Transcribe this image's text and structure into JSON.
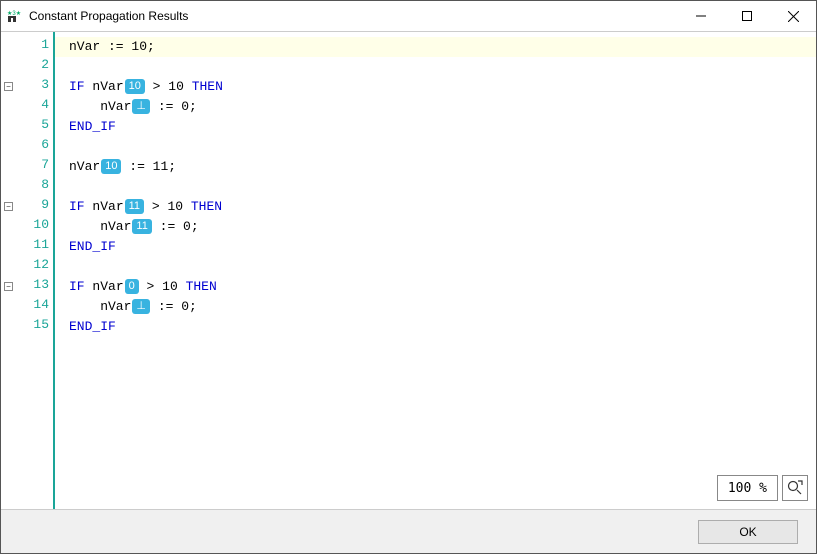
{
  "window": {
    "title": "Constant Propagation Results"
  },
  "zoom": {
    "label": "100 %"
  },
  "buttons": {
    "ok": "OK"
  },
  "line_h": 20,
  "top_off": 5,
  "folds": [
    3,
    9,
    13
  ],
  "code": [
    {
      "n": 1,
      "hl": true,
      "segs": [
        {
          "t": "nVar := 10;"
        }
      ]
    },
    {
      "n": 2,
      "segs": []
    },
    {
      "n": 3,
      "segs": [
        {
          "t": "IF",
          "kw": true
        },
        {
          "t": " nVar"
        },
        {
          "b": "10"
        },
        {
          "t": " > 10 "
        },
        {
          "t": "THEN",
          "kw": true
        }
      ]
    },
    {
      "n": 4,
      "segs": [
        {
          "t": "    nVar"
        },
        {
          "b": "⊥"
        },
        {
          "t": " := 0;"
        }
      ]
    },
    {
      "n": 5,
      "segs": [
        {
          "t": "END_IF",
          "kw": true
        }
      ]
    },
    {
      "n": 6,
      "segs": []
    },
    {
      "n": 7,
      "segs": [
        {
          "t": "nVar"
        },
        {
          "b": "10"
        },
        {
          "t": " := 11;"
        }
      ]
    },
    {
      "n": 8,
      "segs": []
    },
    {
      "n": 9,
      "segs": [
        {
          "t": "IF",
          "kw": true
        },
        {
          "t": " nVar"
        },
        {
          "b": "11"
        },
        {
          "t": " > 10 "
        },
        {
          "t": "THEN",
          "kw": true
        }
      ]
    },
    {
      "n": 10,
      "segs": [
        {
          "t": "    nVar"
        },
        {
          "b": "11"
        },
        {
          "t": " := 0;"
        }
      ]
    },
    {
      "n": 11,
      "segs": [
        {
          "t": "END_IF",
          "kw": true
        }
      ]
    },
    {
      "n": 12,
      "segs": []
    },
    {
      "n": 13,
      "segs": [
        {
          "t": "IF",
          "kw": true
        },
        {
          "t": " nVar"
        },
        {
          "b": "0"
        },
        {
          "t": " > 10 "
        },
        {
          "t": "THEN",
          "kw": true
        }
      ]
    },
    {
      "n": 14,
      "segs": [
        {
          "t": "    nVar"
        },
        {
          "b": "⊥"
        },
        {
          "t": " := 0;"
        }
      ]
    },
    {
      "n": 15,
      "segs": [
        {
          "t": "END_IF",
          "kw": true
        }
      ]
    }
  ]
}
